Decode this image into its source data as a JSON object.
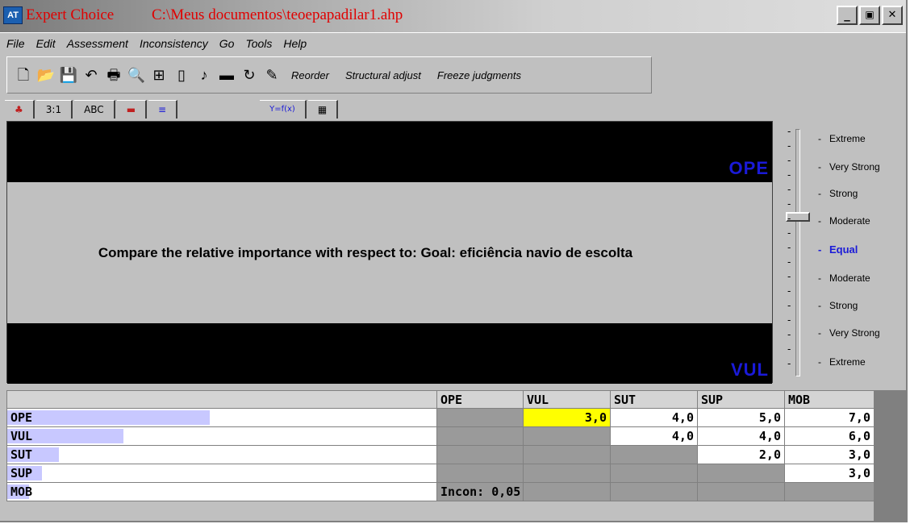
{
  "window": {
    "app_icon": "AT",
    "app_name": "Expert Choice",
    "file_path": "C:\\Meus documentos\\teoepapadilar1.ahp",
    "minimize": "_",
    "restore": "▣",
    "close": "✕"
  },
  "menu": [
    "File",
    "Edit",
    "Assessment",
    "Inconsistency",
    "Go",
    "Tools",
    "Help"
  ],
  "toolbar": {
    "icons": [
      "new-file-icon",
      "open-folder-icon",
      "save-disk-icon",
      "undo-arrow-icon",
      "print-icon",
      "print-preview-icon",
      "hierarchy-icon",
      "calculator-icon",
      "music-note-icon",
      "rectangle-icon",
      "refresh-icon",
      "wand-icon"
    ],
    "reorder": "Reorder",
    "structural_adjust": "Structural adjust",
    "freeze_judgments": "Freeze judgments"
  },
  "tabs": [
    {
      "name": "tab-color",
      "label": "♣"
    },
    {
      "name": "tab-numerical",
      "label": "3:1"
    },
    {
      "name": "tab-verbal",
      "label": "ABC"
    },
    {
      "name": "tab-graphical",
      "label": "▬"
    },
    {
      "name": "tab-bars",
      "label": "≡"
    },
    {
      "name": "tab-formula",
      "label": "Y=f(x)"
    },
    {
      "name": "tab-matrix",
      "label": "▦"
    }
  ],
  "compare": {
    "top_label": "OPE",
    "bottom_label": "VUL",
    "prompt": "Compare the relative importance  with respect to: Goal: eficiência navio de escolta"
  },
  "scale": {
    "items": [
      "Extreme",
      "Very Strong",
      "Strong",
      "Moderate",
      "Equal",
      "Moderate",
      "Strong",
      "Very Strong",
      "Extreme"
    ],
    "selected": "Moderate"
  },
  "matrix": {
    "columns": [
      "OPE",
      "VUL",
      "SUT",
      "SUP",
      "MOB"
    ],
    "rows": [
      {
        "label": "OPE",
        "priority": 0.47,
        "cells": [
          "",
          "3,0",
          "4,0",
          "5,0",
          "7,0"
        ]
      },
      {
        "label": "VUL",
        "priority": 0.27,
        "cells": [
          "",
          "",
          "4,0",
          "4,0",
          "6,0"
        ]
      },
      {
        "label": "SUT",
        "priority": 0.12,
        "cells": [
          "",
          "",
          "",
          "2,0",
          "3,0"
        ]
      },
      {
        "label": "SUP",
        "priority": 0.08,
        "cells": [
          "",
          "",
          "",
          "",
          "3,0"
        ]
      },
      {
        "label": "MOB",
        "priority": 0.05,
        "cells": [
          "",
          "",
          "",
          "",
          ""
        ]
      }
    ],
    "inconsistency": "Incon: 0,05",
    "highlight_color": "#ffff00",
    "priority_bar_color": "#c8c8ff"
  }
}
